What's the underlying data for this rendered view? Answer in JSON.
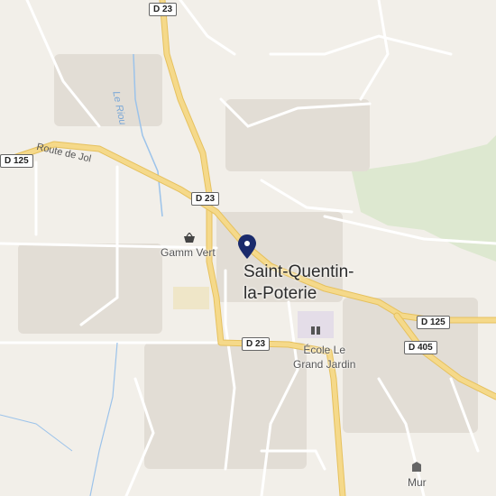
{
  "map": {
    "town_name_line1": "Saint-Quentin-",
    "town_name_line2": "la-Poterie",
    "pois": {
      "gamm_vert": "Gamm Vert",
      "ecole_line1": "École Le",
      "ecole_line2": "Grand Jardin",
      "mur": "Mur"
    },
    "road_shields": {
      "top": "D 23",
      "middle": "D 23",
      "bottom": "D 23",
      "left": "D 125",
      "right": "D 125",
      "d405": "D 405"
    },
    "road_name": "Route de Jol",
    "river": "Le Riou",
    "icons": {
      "location_pin": "map-pin-icon",
      "shop": "basket-icon",
      "school": "school-icon",
      "mur": "building-icon"
    },
    "colors": {
      "background": "#f2efe9",
      "road_major": "#f5d98a",
      "road_major_border": "#e6c15e",
      "road_minor": "#ffffff",
      "forest": "#dde8d0",
      "water": "#9cc3ea",
      "pin": "#1a2a6c",
      "school_area": "#e4dde8"
    }
  }
}
